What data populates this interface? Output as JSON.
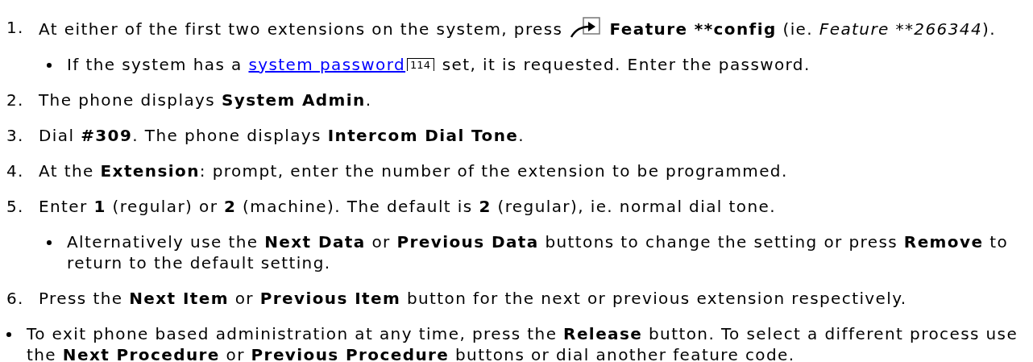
{
  "steps": [
    {
      "number": "1.",
      "segments": [
        {
          "kind": "plain",
          "text": "At either of the first two extensions on the system, press "
        },
        {
          "kind": "feature-icon"
        },
        {
          "kind": "bold",
          "text": " Feature **config"
        },
        {
          "kind": "plain",
          "text": " (ie. "
        },
        {
          "kind": "italic",
          "text": "Feature **266344"
        },
        {
          "kind": "plain",
          "text": ")."
        }
      ],
      "subitems": [
        {
          "segments": [
            {
              "kind": "plain",
              "text": "If the system has a "
            },
            {
              "kind": "link",
              "text": "system password"
            },
            {
              "kind": "page-ref",
              "text": "114"
            },
            {
              "kind": "plain",
              "text": " set, it is requested. Enter the password."
            }
          ]
        }
      ]
    },
    {
      "number": "2.",
      "segments": [
        {
          "kind": "plain",
          "text": "The phone displays "
        },
        {
          "kind": "bold",
          "text": "System Admin"
        },
        {
          "kind": "plain",
          "text": "."
        }
      ]
    },
    {
      "number": "3.",
      "segments": [
        {
          "kind": "plain",
          "text": "Dial "
        },
        {
          "kind": "bold",
          "text": "#309"
        },
        {
          "kind": "plain",
          "text": ". The phone displays "
        },
        {
          "kind": "bold",
          "text": "Intercom Dial Tone"
        },
        {
          "kind": "plain",
          "text": "."
        }
      ]
    },
    {
      "number": "4.",
      "segments": [
        {
          "kind": "plain",
          "text": "At the "
        },
        {
          "kind": "bold",
          "text": "Extension"
        },
        {
          "kind": "plain",
          "text": ": prompt, enter the number of the extension to be programmed."
        }
      ]
    },
    {
      "number": "5.",
      "segments": [
        {
          "kind": "plain",
          "text": "Enter "
        },
        {
          "kind": "bold",
          "text": "1"
        },
        {
          "kind": "plain",
          "text": " (regular) or "
        },
        {
          "kind": "bold",
          "text": "2"
        },
        {
          "kind": "plain",
          "text": " (machine). The default is "
        },
        {
          "kind": "bold",
          "text": "2"
        },
        {
          "kind": "plain",
          "text": " (regular), ie. normal dial tone."
        }
      ],
      "subitems": [
        {
          "segments": [
            {
              "kind": "plain",
              "text": "Alternatively use the "
            },
            {
              "kind": "bold",
              "text": "Next Data"
            },
            {
              "kind": "plain",
              "text": " or "
            },
            {
              "kind": "bold",
              "text": "Previous Data"
            },
            {
              "kind": "plain",
              "text": " buttons to change the setting or press "
            },
            {
              "kind": "bold",
              "text": "Remove"
            },
            {
              "kind": "plain",
              "text": " to return to the default setting."
            }
          ]
        }
      ]
    },
    {
      "number": "6.",
      "segments": [
        {
          "kind": "plain",
          "text": "Press the "
        },
        {
          "kind": "bold",
          "text": "Next Item"
        },
        {
          "kind": "plain",
          "text": " or "
        },
        {
          "kind": "bold",
          "text": "Previous Item"
        },
        {
          "kind": "plain",
          "text": " button for the next or previous extension respectively."
        }
      ]
    }
  ],
  "notes": [
    {
      "segments": [
        {
          "kind": "plain",
          "text": "To exit phone based administration at any time, press the "
        },
        {
          "kind": "bold",
          "text": "Release"
        },
        {
          "kind": "plain",
          "text": " button. To select a different process use the "
        },
        {
          "kind": "bold",
          "text": "Next Procedure"
        },
        {
          "kind": "plain",
          "text": " or "
        },
        {
          "kind": "bold",
          "text": "Previous Procedure"
        },
        {
          "kind": "plain",
          "text": " buttons or dial another feature code."
        }
      ]
    }
  ]
}
